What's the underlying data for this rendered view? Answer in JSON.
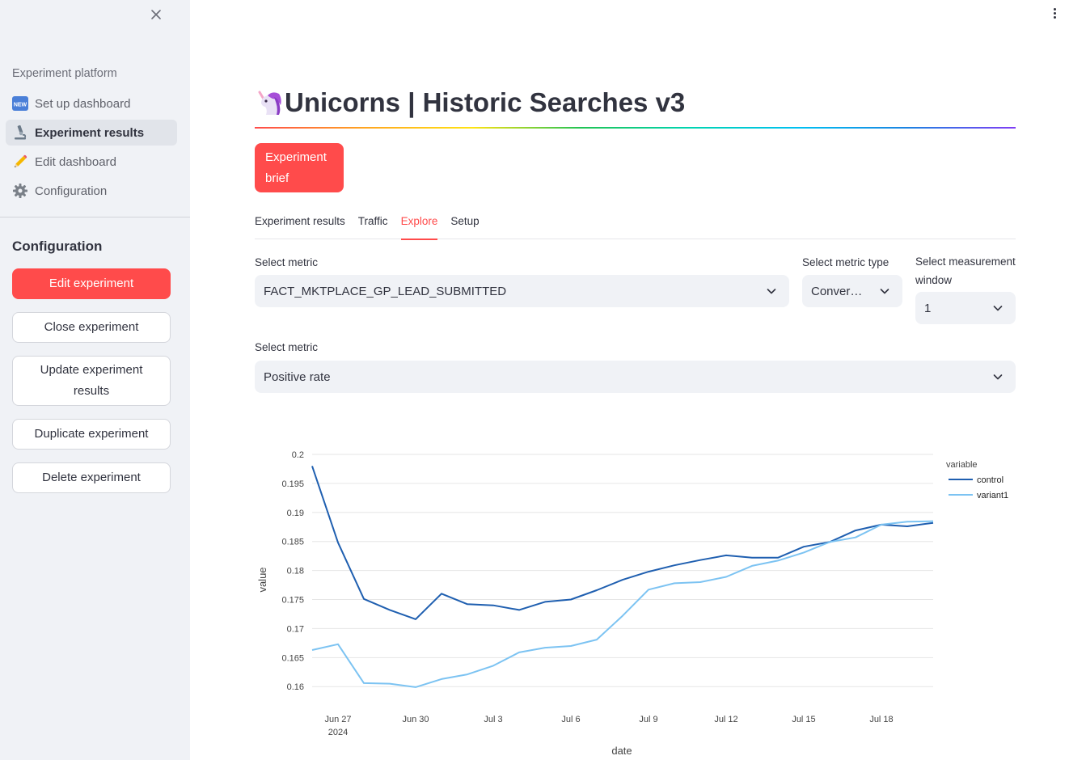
{
  "sidebar": {
    "heading": "Experiment platform",
    "nav": [
      {
        "label": "Set up dashboard",
        "icon": "new-badge-icon"
      },
      {
        "label": "Experiment results",
        "icon": "microscope-icon"
      },
      {
        "label": "Edit dashboard",
        "icon": "pencil-icon"
      },
      {
        "label": "Configuration",
        "icon": "gear-icon"
      }
    ],
    "config_title": "Configuration",
    "buttons": {
      "edit": "Edit experiment",
      "close": "Close experiment",
      "update": "Update experiment results",
      "duplicate": "Duplicate experiment",
      "delete": "Delete experiment"
    }
  },
  "main": {
    "title": "Unicorns | Historic Searches v3",
    "title_icon": "unicorn-icon",
    "brief_button": "Experiment brief",
    "tabs": [
      "Experiment results",
      "Traffic",
      "Explore",
      "Setup"
    ],
    "active_tab": "Explore",
    "filters": {
      "metric_label": "Select metric",
      "metric_value": "FACT_MKTPLACE_GP_LEAD_SUBMITTED",
      "metric_type_label": "Select metric type",
      "metric_type_value": "Conver…",
      "window_label": "Select measurement window",
      "window_value": "1",
      "metric2_label": "Select metric",
      "metric2_value": "Positive rate"
    }
  },
  "colors": {
    "accent": "#ff4b4b",
    "control": "#1f5fb0",
    "variant1": "#7cc3f2"
  },
  "chart_data": {
    "type": "line",
    "xlabel": "date",
    "ylabel": "value",
    "legend_title": "variable",
    "legend_position": "top-right",
    "grid": true,
    "ylim": [
      0.1585,
      0.2
    ],
    "yticks": [
      0.16,
      0.165,
      0.17,
      0.175,
      0.18,
      0.185,
      0.19,
      0.195,
      0.2
    ],
    "ytick_labels": [
      "0.16",
      "0.165",
      "0.17",
      "0.175",
      "0.18",
      "0.185",
      "0.19",
      "0.195",
      "0.2"
    ],
    "x": [
      "2024-06-26",
      "2024-06-27",
      "2024-06-28",
      "2024-06-29",
      "2024-06-30",
      "2024-07-01",
      "2024-07-02",
      "2024-07-03",
      "2024-07-04",
      "2024-07-05",
      "2024-07-06",
      "2024-07-07",
      "2024-07-08",
      "2024-07-09",
      "2024-07-10",
      "2024-07-11",
      "2024-07-12",
      "2024-07-13",
      "2024-07-14",
      "2024-07-15",
      "2024-07-16",
      "2024-07-17",
      "2024-07-18",
      "2024-07-19",
      "2024-07-20"
    ],
    "xticks": [
      "2024-06-27",
      "2024-06-30",
      "2024-07-03",
      "2024-07-06",
      "2024-07-09",
      "2024-07-12",
      "2024-07-15",
      "2024-07-18"
    ],
    "xtick_labels": [
      "Jun 27",
      "Jun 30",
      "Jul 3",
      "Jul 6",
      "Jul 9",
      "Jul 12",
      "Jul 15",
      "Jul 18"
    ],
    "xtick_sublabel": "2024",
    "series": [
      {
        "name": "control",
        "values": [
          0.198,
          0.1848,
          0.1751,
          0.1732,
          0.1716,
          0.176,
          0.1742,
          0.174,
          0.1732,
          0.1746,
          0.175,
          0.1766,
          0.1784,
          0.1798,
          0.1809,
          0.1818,
          0.1826,
          0.1822,
          0.1822,
          0.1841,
          0.1849,
          0.1869,
          0.1879,
          0.1876,
          0.1882
        ]
      },
      {
        "name": "variant1",
        "values": [
          0.1663,
          0.1673,
          0.1606,
          0.1605,
          0.1599,
          0.1613,
          0.1621,
          0.1636,
          0.1659,
          0.1667,
          0.167,
          0.1681,
          0.1722,
          0.1767,
          0.1778,
          0.178,
          0.1789,
          0.1808,
          0.1817,
          0.1831,
          0.1849,
          0.1857,
          0.1879,
          0.1884,
          0.1885
        ]
      }
    ]
  }
}
